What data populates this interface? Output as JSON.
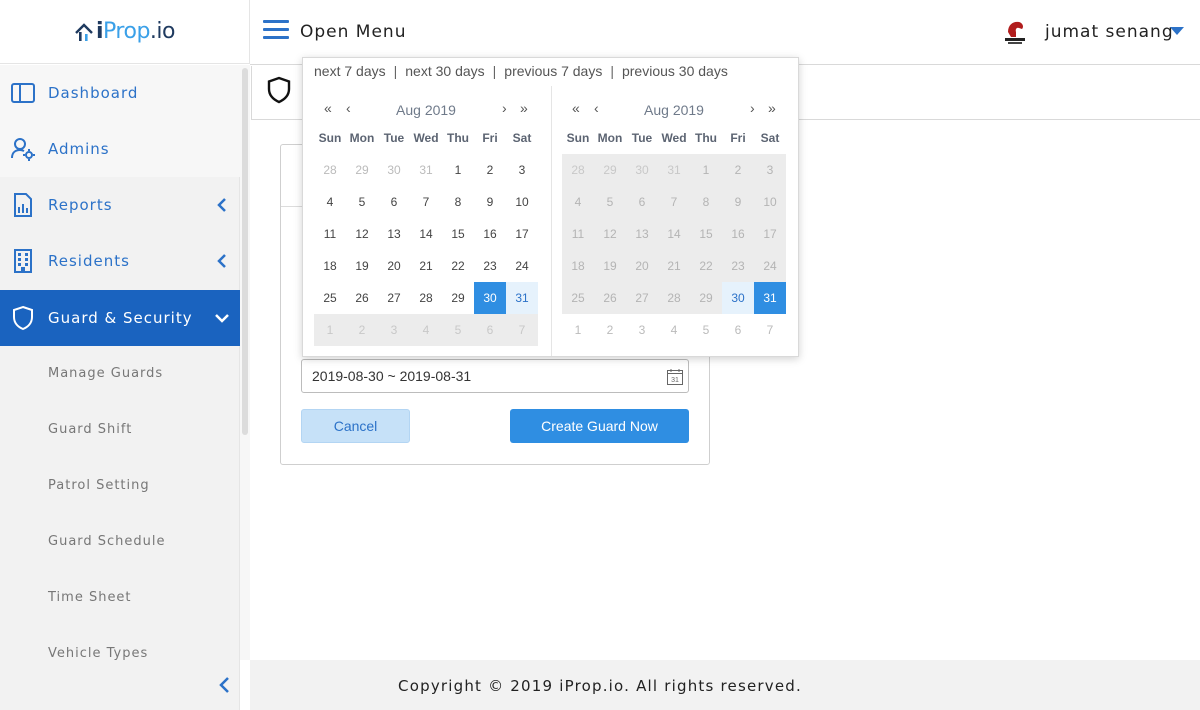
{
  "brand": {
    "logo_text_1": "i",
    "logo_text_2": "Prop",
    "logo_text_3": ".io"
  },
  "header": {
    "menu_label": "Open Menu",
    "user_name": "jumat senang"
  },
  "sidebar": {
    "items": [
      {
        "label": "Dashboard"
      },
      {
        "label": "Admins"
      },
      {
        "label": "Reports"
      },
      {
        "label": "Residents"
      },
      {
        "label": "Guard & Security"
      }
    ],
    "sub_items": [
      {
        "label": "Manage Guards"
      },
      {
        "label": "Guard Shift"
      },
      {
        "label": "Patrol Setting"
      },
      {
        "label": "Guard Schedule"
      },
      {
        "label": "Time Sheet"
      },
      {
        "label": "Vehicle Types"
      }
    ]
  },
  "picker": {
    "shortcuts": [
      "next 7 days",
      "next 30 days",
      "previous 7 days",
      "previous 30 days"
    ],
    "separator": "|",
    "nav": {
      "prev_year": "«",
      "prev_month": "‹",
      "next_month": "›",
      "next_year": "»"
    },
    "days_of_week": [
      "Sun",
      "Mon",
      "Tue",
      "Wed",
      "Thu",
      "Fri",
      "Sat"
    ],
    "left": {
      "title": "Aug 2019",
      "weeks": [
        [
          [
            "28",
            "muted"
          ],
          [
            "29",
            "muted"
          ],
          [
            "30",
            "muted"
          ],
          [
            "31",
            "muted"
          ],
          [
            "1",
            ""
          ],
          [
            "2",
            ""
          ],
          [
            "3",
            ""
          ]
        ],
        [
          [
            "4",
            ""
          ],
          [
            "5",
            ""
          ],
          [
            "6",
            ""
          ],
          [
            "7",
            ""
          ],
          [
            "8",
            ""
          ],
          [
            "9",
            ""
          ],
          [
            "10",
            ""
          ]
        ],
        [
          [
            "11",
            ""
          ],
          [
            "12",
            ""
          ],
          [
            "13",
            ""
          ],
          [
            "14",
            ""
          ],
          [
            "15",
            ""
          ],
          [
            "16",
            ""
          ],
          [
            "17",
            ""
          ]
        ],
        [
          [
            "18",
            ""
          ],
          [
            "19",
            ""
          ],
          [
            "20",
            ""
          ],
          [
            "21",
            ""
          ],
          [
            "22",
            ""
          ],
          [
            "23",
            ""
          ],
          [
            "24",
            ""
          ]
        ],
        [
          [
            "25",
            ""
          ],
          [
            "26",
            ""
          ],
          [
            "27",
            ""
          ],
          [
            "28",
            ""
          ],
          [
            "29",
            ""
          ],
          [
            "30",
            "sel"
          ],
          [
            "31",
            "range"
          ]
        ],
        [
          [
            "1",
            "dis muted"
          ],
          [
            "2",
            "dis muted"
          ],
          [
            "3",
            "dis muted"
          ],
          [
            "4",
            "dis muted"
          ],
          [
            "5",
            "dis muted"
          ],
          [
            "6",
            "dis muted"
          ],
          [
            "7",
            "dis muted"
          ]
        ]
      ]
    },
    "right": {
      "title": "Aug 2019",
      "weeks": [
        [
          [
            "28",
            "dis muted"
          ],
          [
            "29",
            "dis muted"
          ],
          [
            "30",
            "dis muted"
          ],
          [
            "31",
            "dis muted"
          ],
          [
            "1",
            "dis"
          ],
          [
            "2",
            "dis"
          ],
          [
            "3",
            "dis"
          ]
        ],
        [
          [
            "4",
            "dis"
          ],
          [
            "5",
            "dis"
          ],
          [
            "6",
            "dis"
          ],
          [
            "7",
            "dis"
          ],
          [
            "8",
            "dis"
          ],
          [
            "9",
            "dis"
          ],
          [
            "10",
            "dis"
          ]
        ],
        [
          [
            "11",
            "dis"
          ],
          [
            "12",
            "dis"
          ],
          [
            "13",
            "dis"
          ],
          [
            "14",
            "dis"
          ],
          [
            "15",
            "dis"
          ],
          [
            "16",
            "dis"
          ],
          [
            "17",
            "dis"
          ]
        ],
        [
          [
            "18",
            "dis"
          ],
          [
            "19",
            "dis"
          ],
          [
            "20",
            "dis"
          ],
          [
            "21",
            "dis"
          ],
          [
            "22",
            "dis"
          ],
          [
            "23",
            "dis"
          ],
          [
            "24",
            "dis"
          ]
        ],
        [
          [
            "25",
            "dis"
          ],
          [
            "26",
            "dis"
          ],
          [
            "27",
            "dis"
          ],
          [
            "28",
            "dis"
          ],
          [
            "29",
            "dis"
          ],
          [
            "30",
            "range"
          ],
          [
            "31",
            "sel"
          ]
        ],
        [
          [
            "1",
            "muted"
          ],
          [
            "2",
            "muted"
          ],
          [
            "3",
            "muted"
          ],
          [
            "4",
            "muted"
          ],
          [
            "5",
            "muted"
          ],
          [
            "6",
            "muted"
          ],
          [
            "7",
            "muted"
          ]
        ]
      ]
    }
  },
  "form": {
    "date_range_value": "2019-08-30 ~ 2019-08-31",
    "calendar_icon_text": "31",
    "cancel_label": "Cancel",
    "create_label": "Create Guard Now"
  },
  "footer": {
    "copyright": "Copyright © 2019 iProp.io. All rights reserved."
  },
  "colors": {
    "accent": "#1a63bf",
    "primary_button": "#2f8ee2",
    "cancel_button": "#c6e1f8"
  }
}
